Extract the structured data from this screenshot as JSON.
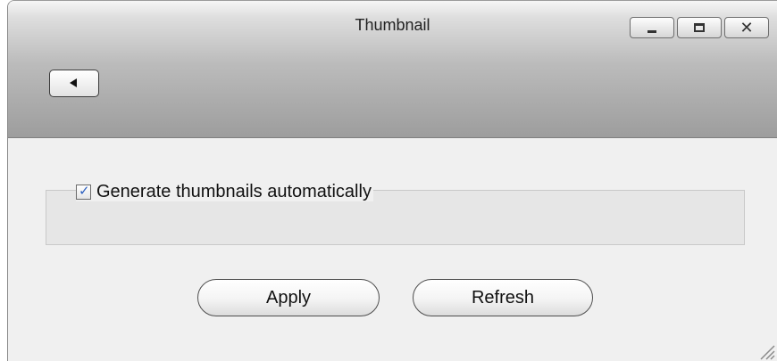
{
  "window": {
    "title": "Thumbnail",
    "controls": {
      "minimize_icon": "minimize-icon",
      "maximize_icon": "maximize-icon",
      "close_icon": "close-icon",
      "close_glyph": "✕"
    }
  },
  "toolbar": {
    "back_icon": "back-arrow-icon"
  },
  "settings": {
    "generate_thumbnails_label": "Generate thumbnails automatically",
    "generate_thumbnails_checked": true,
    "check_glyph": "✓"
  },
  "actions": {
    "apply_label": "Apply",
    "refresh_label": "Refresh"
  },
  "colors": {
    "checkmark": "#2b5fbf",
    "titlebar_top": "#f6f6f6",
    "titlebar_bottom": "#9d9d9d",
    "content_bg": "#f0f0f0"
  }
}
